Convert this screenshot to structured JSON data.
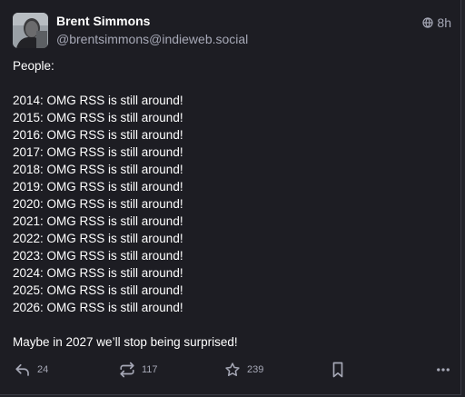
{
  "author": {
    "display_name": "Brent Simmons",
    "handle": "@brentsimmons@indieweb.social"
  },
  "meta": {
    "visibility_icon": "globe-icon",
    "time": "8h"
  },
  "post": {
    "intro": "People:",
    "lines": [
      "2014: OMG RSS is still around!",
      "2015: OMG RSS is still around!",
      "2016: OMG RSS is still around!",
      "2017: OMG RSS is still around!",
      "2018: OMG RSS is still around!",
      "2019: OMG RSS is still around!",
      "2020: OMG RSS is still around!",
      "2021: OMG RSS is still around!",
      "2022: OMG RSS is still around!",
      "2023: OMG RSS is still around!",
      "2024: OMG RSS is still around!",
      "2025: OMG RSS is still around!",
      "2026: OMG RSS is still around!"
    ],
    "closing": "Maybe in 2027 we’ll stop being surprised!"
  },
  "actions": {
    "reply": {
      "icon": "reply-icon",
      "count": "24"
    },
    "boost": {
      "icon": "boost-icon",
      "count": "117"
    },
    "favourite": {
      "icon": "star-icon",
      "count": "239"
    },
    "bookmark": {
      "icon": "bookmark-icon"
    },
    "more": {
      "icon": "more-icon"
    }
  },
  "colors": {
    "background": "#1d1d23",
    "text": "#ffffff",
    "secondary_text": "#a6a8b6"
  }
}
